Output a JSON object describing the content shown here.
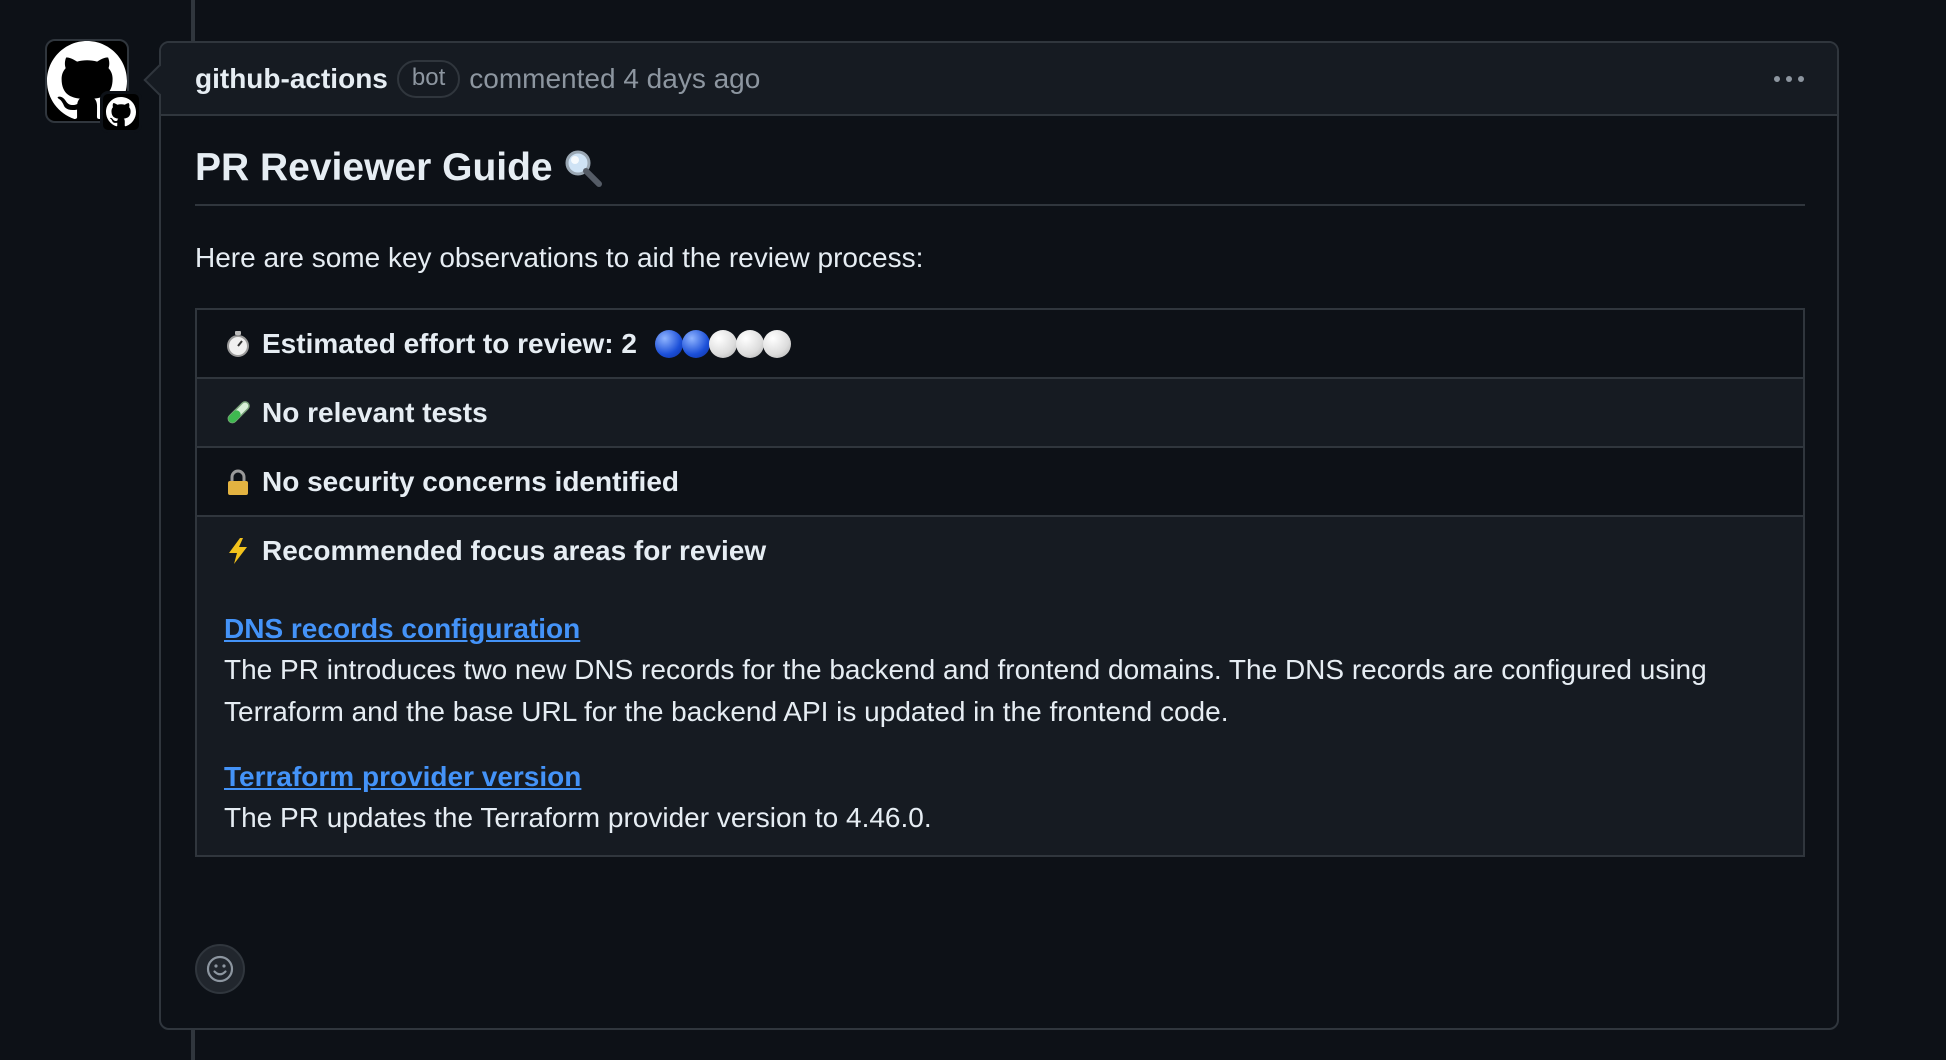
{
  "comment": {
    "author": "github-actions",
    "badge": "bot",
    "meta": "commented 4 days ago"
  },
  "guide": {
    "title": "PR Reviewer Guide",
    "intro": "Here are some key observations to aid the review process:",
    "effort_label": "Estimated effort to review: 2",
    "effort_level": 2,
    "effort_max": 5,
    "tests_label": "No relevant tests",
    "security_label": "No security concerns identified",
    "focus_title": "Recommended focus areas for review",
    "focus_areas": [
      {
        "link": "DNS records configuration",
        "description": "The PR introduces two new DNS records for the backend and frontend domains. The DNS records are configured using Terraform and the base URL for the backend API is updated in the frontend code."
      },
      {
        "link": "Terraform provider version",
        "description": "The PR updates the Terraform provider version to 4.46.0."
      }
    ]
  },
  "colors": {
    "background": "#0d1117",
    "header": "#161b22",
    "border": "#30363d",
    "link": "#4493f8",
    "muted": "#8d96a0"
  }
}
